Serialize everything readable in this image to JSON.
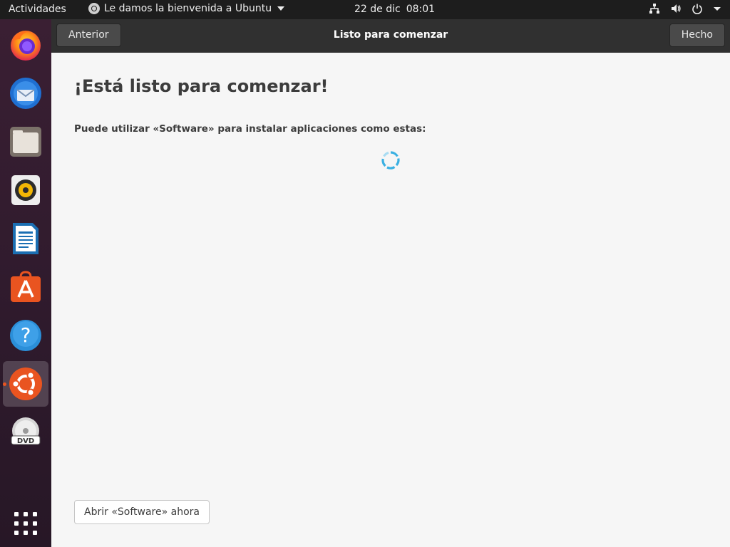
{
  "topbar": {
    "activities": "Actividades",
    "app_menu_label": "Le damos la bienvenida a Ubuntu",
    "date": "22 de dic",
    "time": "08:01",
    "tray_icons": [
      "network-icon",
      "volume-icon",
      "power-icon",
      "chevron-down-icon"
    ]
  },
  "dock": {
    "items": [
      {
        "name": "Firefox",
        "icon": "firefox-icon"
      },
      {
        "name": "Thunderbird",
        "icon": "thunderbird-icon"
      },
      {
        "name": "Archivos",
        "icon": "files-icon"
      },
      {
        "name": "Rhythmbox",
        "icon": "rhythmbox-icon"
      },
      {
        "name": "LibreOffice Writer",
        "icon": "writer-icon"
      },
      {
        "name": "Ubuntu Software",
        "icon": "software-icon"
      },
      {
        "name": "Ayuda",
        "icon": "help-icon"
      },
      {
        "name": "Ubuntu",
        "icon": "ubuntu-icon",
        "active": true
      },
      {
        "name": "DVD",
        "icon": "dvd-icon"
      }
    ],
    "show_apps_icon": "grid-icon"
  },
  "window": {
    "back_button": "Anterior",
    "title": "Listo para comenzar",
    "done_button": "Hecho",
    "heading": "¡Está listo para comenzar!",
    "subheading": "Puede utilizar «Software» para instalar aplicaciones como estas:",
    "loading": true,
    "open_software_button": "Abrir «Software» ahora"
  },
  "colors": {
    "accent": "#e95420",
    "spinner": "#3ab0e2",
    "topbar": "#1d1d1d",
    "headerbar": "#303030"
  }
}
